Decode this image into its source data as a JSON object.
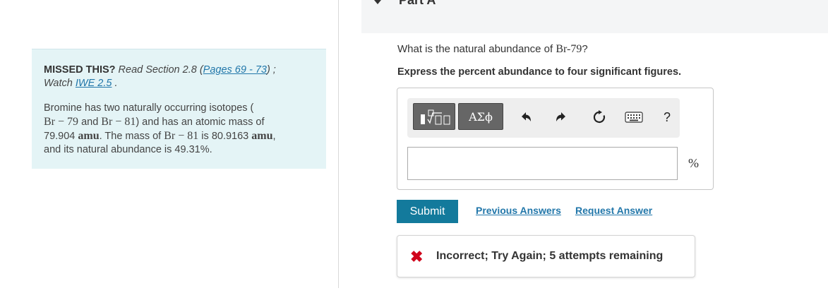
{
  "hint": {
    "missed_label": "MISSED THIS?",
    "read_section": "Read Section 2.8 (",
    "pages_link": "Pages 69 - 73",
    "read_end": ") ;",
    "watch": "Watch",
    "iwe_link": "IWE 2.5",
    "watch_end": ".",
    "p1": "Bromine has two naturally occurring isotopes (",
    "iso1": "Br − 79",
    "and": "and",
    "iso2": "Br − 81",
    "p2": ") and has an atomic mass of",
    "mass1": "79.904",
    "amu": "amu",
    "p3": ". The mass of",
    "iso3": "Br − 81",
    "is": "is",
    "mass2": "80.9163",
    "amu2": "amu",
    "comma": ",",
    "p4": "and its natural abundance is 49.31%."
  },
  "part": {
    "title": "Part A"
  },
  "question": {
    "prefix": "What is the natural abundance of",
    "isotope": "Br-79",
    "suffix": "?",
    "instruction": "Express the percent abundance to four significant figures."
  },
  "toolbar": {
    "greek_label": "ΑΣϕ",
    "undo": "↶",
    "redo": "↷",
    "reset": "↻",
    "keyboard": "⌨",
    "help": "?"
  },
  "answer": {
    "value": "",
    "unit": "%"
  },
  "actions": {
    "submit": "Submit",
    "previous_answers": "Previous Answers",
    "request_answer": "Request Answer"
  },
  "feedback": {
    "icon": "✖",
    "text": "Incorrect; Try Again; 5 attempts remaining"
  }
}
